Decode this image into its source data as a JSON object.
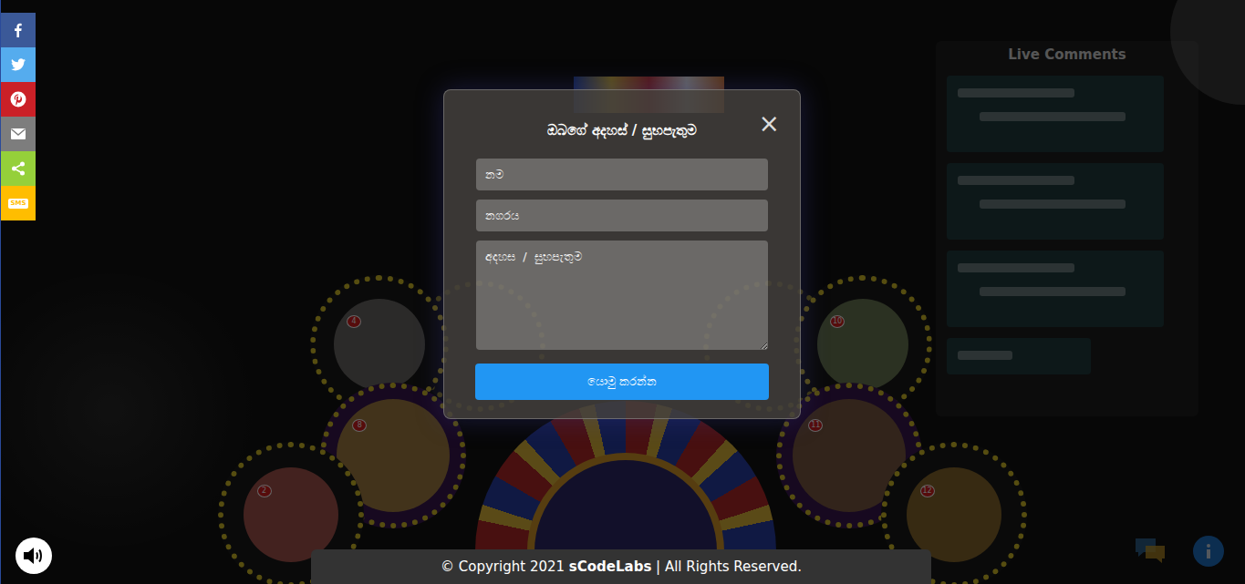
{
  "share_bar": [
    {
      "kind": "facebook",
      "color": "#3b5998"
    },
    {
      "kind": "twitter",
      "color": "#55acee"
    },
    {
      "kind": "pinterest",
      "color": "#cb2027"
    },
    {
      "kind": "email",
      "color": "#7d7d7d"
    },
    {
      "kind": "share",
      "color": "#95d03a"
    },
    {
      "kind": "sms",
      "color": "#ffbd00",
      "text": "SMS"
    }
  ],
  "live_comments": {
    "title": "Live Comments"
  },
  "wheel": {
    "items": [
      {
        "number": "4"
      },
      {
        "number": "10"
      },
      {
        "number": "8"
      },
      {
        "number": "11"
      },
      {
        "number": "2"
      },
      {
        "number": "12"
      }
    ]
  },
  "modal": {
    "title": "ඔබගේ අදහස් / සුභපැතුම",
    "close": "×",
    "fields": [
      {
        "kind": "input",
        "placeholder": "නම"
      },
      {
        "kind": "input",
        "placeholder": "නගරය"
      },
      {
        "kind": "textarea",
        "placeholder": "අදහස  /  සුභපැතුම"
      }
    ],
    "submit": "යොමු කරන්න"
  },
  "footer": {
    "prefix": "© Copyright 2021 ",
    "brand": "sCodeLabs",
    "suffix": " | All Rights Reserved."
  }
}
